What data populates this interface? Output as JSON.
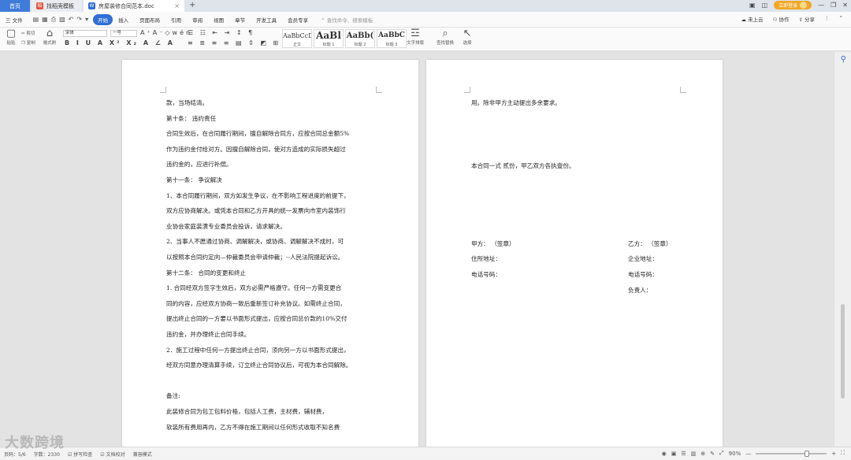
{
  "tabs": {
    "home": "首页",
    "template": "找稻壳模板",
    "template_icon": "稻",
    "doc": "房屋装修合同范本.doc",
    "doc_icon": "W",
    "close": "×",
    "new_tab": "+"
  },
  "window": {
    "login": "立即登录"
  },
  "menu": {
    "file": "三 文件",
    "items": [
      "开始",
      "插入",
      "页面布局",
      "引用",
      "审阅",
      "视图",
      "章节",
      "开发工具",
      "会员专享"
    ],
    "active_index": 0,
    "search_placeholder": "查找命令、搜索模板",
    "cloud": "未上云",
    "collab": "协作",
    "share": "分享"
  },
  "ribbon": {
    "paste": "粘贴",
    "cut": "剪切",
    "copy": "复制",
    "format_painter": "格式刷",
    "font_name": "宋体",
    "font_size": "一号",
    "styles": [
      {
        "preview": "AaBbCcDd",
        "label": "正文"
      },
      {
        "preview": "AaBl",
        "label": "标题 1"
      },
      {
        "preview": "AaBb(",
        "label": "标题 2"
      },
      {
        "preview": "AaBbC",
        "label": "标题 3"
      }
    ],
    "text_layout": "文字排版",
    "find_replace": "查找替换",
    "select": "选择"
  },
  "document": {
    "left_page": [
      "款，当场结清。",
      "第十条：  违约责任",
      "合同生效后，在合同履行期间，擅自解除合同方，应按合同总金额5%",
      "作为违约金付给对方。因擅自解除合同，使对方造成的实际损失超过",
      "违约金的，应进行补偿。",
      "第十一条：  争议解决",
      "1、本合同履行期间，双方如发生争议，在不影响工程进度的前提下，",
      "双方应协商解决。或凭本合同和乙方开具的统一发票向市室内装饰行",
      "业协会家庭装潢专业委员会投诉，请求解决。",
      "2、当事人不愿通过协商、调解解决，或协商、调解解决不成时，可",
      "以按照本合同约定向—仲裁委员会申请仲裁；--人民法院提起诉讼。",
      "第十二条：  合同的变更和终止",
      "1.   合同经双方签字生效后，双方必需严格遵守。任何一方需变更合",
      "同的内容，应经双方协商一致后重新签订补充协议。如需终止合同，",
      "提出终止合同的一方要以书面形式提出，应按合同总价款的10%交付",
      "违约金，并办理终止合同手续。",
      "2．施工过程中任何一方提出终止合同，须向另一方以书面形式提出，",
      "经双方同意办理清算手续，订立终止合同协议后，可视为本合同解除。",
      "",
      "备注:",
      "         此装修合同为包工包料价格，包括人工费，主材费，辅材费，",
      "软装所有费用再内，乙方不得在施工期间以任何形式收取不知名费"
    ],
    "right_page": {
      "line1": "用。除非甲方主动提出多余要求。",
      "line2": "本合同一式  贰份，甲乙双方各执壹份。",
      "party_a": "甲方：  （签章）",
      "party_a_addr": "住所地址：",
      "party_a_phone": "电话号码：",
      "party_b": "乙方：  （签章）",
      "party_b_addr": "企业地址：",
      "party_b_phone": "电话号码：",
      "party_b_person": "负责人："
    }
  },
  "status": {
    "page": "页码：5/6",
    "words": "字数：2330",
    "spell": "拼写检查",
    "doc_check": "文档校对",
    "compat": "兼容模式",
    "zoom": "90%",
    "zoom_value": 90
  },
  "watermark": "大数跨境"
}
